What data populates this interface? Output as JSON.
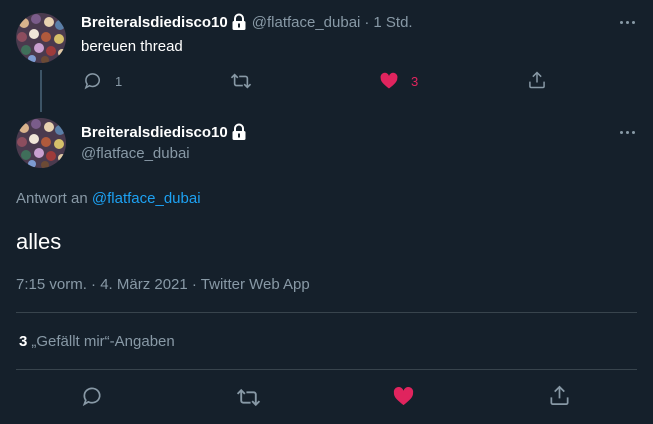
{
  "parent_tweet": {
    "display_name": "Breiteralsdiedisco10",
    "handle": "@flatface_dubai",
    "separator": "·",
    "time": "1 Std.",
    "text": "bereuen thread",
    "reply_count": "1",
    "like_count": "3",
    "liked": true,
    "icons": [
      "avatar",
      "lock-icon",
      "more-icon",
      "reply-icon",
      "retweet-icon",
      "heart-icon",
      "share-icon"
    ]
  },
  "main_tweet": {
    "display_name": "Breiteralsdiedisco10",
    "handle": "@flatface_dubai",
    "reply_prefix": "Antwort an",
    "reply_to": "@flatface_dubai",
    "text": "alles",
    "timestamp": "7:15 vorm. · 4. März 2021 · Twitter Web App",
    "like_count": "3",
    "likes_label": "„Gefällt mir“-Angaben",
    "liked": true
  },
  "colors": {
    "background": "#15202b",
    "text": "#ffffff",
    "muted": "#8899a6",
    "link": "#1da1f2",
    "like": "#e0245e",
    "divider": "#38444d"
  }
}
